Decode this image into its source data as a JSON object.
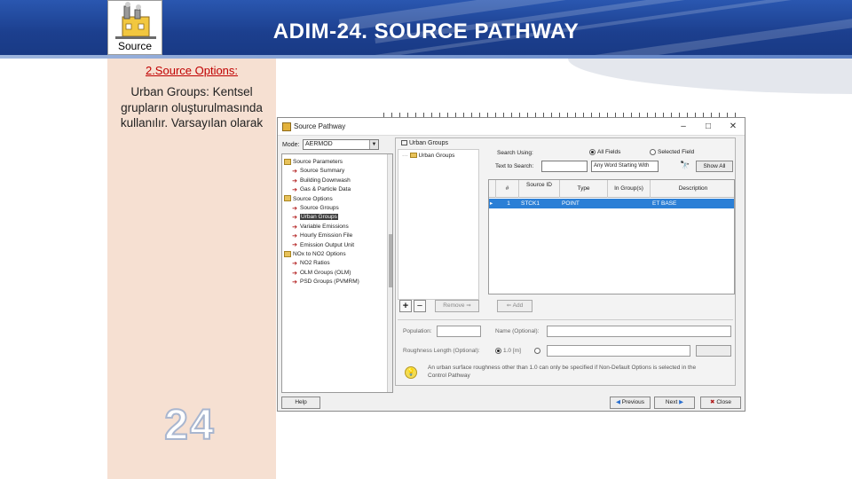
{
  "slide": {
    "title": "ADIM-24. SOURCE PATHWAY",
    "logo_caption": "Source",
    "section_heading": "2.Source Options:",
    "section_body": "Urban Groups: Kentsel grupların oluşturulmasında kullanılır. Varsayılan olarak",
    "slide_number": "24"
  },
  "window": {
    "title": "Source Pathway",
    "controls": [
      "–",
      "□",
      "✕"
    ],
    "model_label": "Mode:",
    "model_value": "AERMOD",
    "tree": [
      {
        "label": "Source Parameters",
        "kind": "folder",
        "level": 0
      },
      {
        "label": "Source Summary",
        "kind": "item",
        "level": 1
      },
      {
        "label": "Building Downwash",
        "kind": "item",
        "level": 1
      },
      {
        "label": "Gas & Particle Data",
        "kind": "item",
        "level": 1
      },
      {
        "label": "Source Options",
        "kind": "folder",
        "level": 0
      },
      {
        "label": "Source Groups",
        "kind": "item",
        "level": 1
      },
      {
        "label": "Urban Groups",
        "kind": "item",
        "level": 1,
        "selected": true
      },
      {
        "label": "Variable Emissions",
        "kind": "item",
        "level": 1
      },
      {
        "label": "Hourly Emission File",
        "kind": "item",
        "level": 1
      },
      {
        "label": "Emission Output Unit",
        "kind": "item",
        "level": 1
      },
      {
        "label": "NOx to NO2 Options",
        "kind": "folder",
        "level": 0
      },
      {
        "label": "NO2 Ratios",
        "kind": "item",
        "level": 1
      },
      {
        "label": "OLM Groups (OLM)",
        "kind": "item",
        "level": 1
      },
      {
        "label": "PSD Groups (PVMRM)",
        "kind": "item",
        "level": 1
      }
    ],
    "groups_title": "Urban Groups",
    "groups_list_item": "Urban Groups",
    "search_using_label": "Search Using:",
    "radio_all": "All Fields",
    "radio_selected": "Selected Field",
    "text_to_search_label": "Text to Search:",
    "word_select": "Any Word Starting With",
    "show_all": "Show All",
    "grid": {
      "columns": [
        "#",
        "Source ID",
        "Type",
        "In Group(s)",
        "Description"
      ],
      "rows": [
        {
          "marker": "▸",
          "num": "1",
          "source_id": "STCK1",
          "type": "POINT",
          "groups": "",
          "description": "ET BASE"
        }
      ]
    },
    "remove_label": "Remove ⇒",
    "add_label": "⇐ Add",
    "population_label": "Population:",
    "name_label": "Name (Optional):",
    "roughness_label": "Roughness Length (Optional):",
    "roughness_value": "1.0",
    "roughness_unit": "[m]",
    "info_text": "An urban surface roughness other than 1.0 can only be specified if Non-Default Options is selected in the Control Pathway",
    "buttons": {
      "help": "Help",
      "previous": "Previous",
      "next": "Next",
      "close": "Close"
    }
  }
}
